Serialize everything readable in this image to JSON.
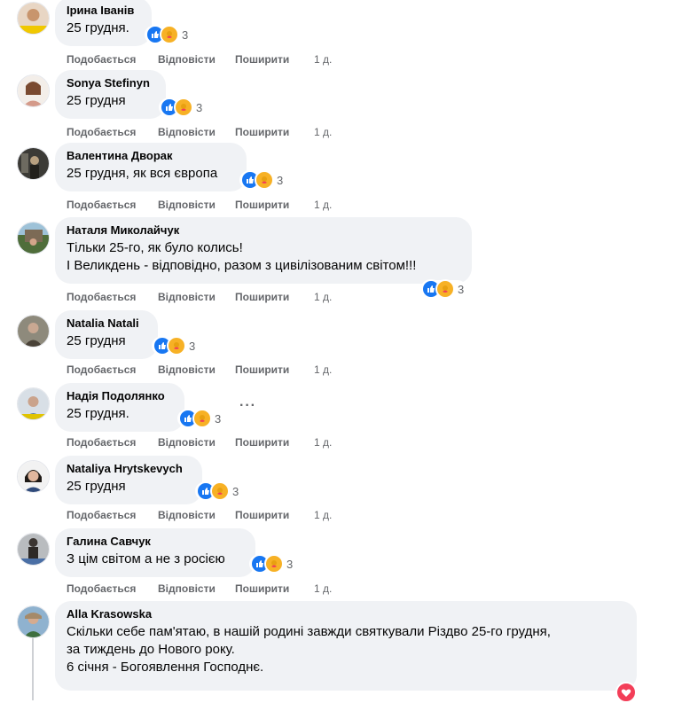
{
  "labels": {
    "like": "Подобається",
    "reply": "Відповісти",
    "share": "Поширити"
  },
  "comments": [
    {
      "author": "Ірина Іванів",
      "lines": [
        "25 грудня."
      ],
      "reactions": "3",
      "time": "1 д."
    },
    {
      "author": "Sonya Stefinyn",
      "lines": [
        "25 грудня"
      ],
      "reactions": "3",
      "time": "1 д."
    },
    {
      "author": "Валентина Дворак",
      "lines": [
        "25 грудня, як вся європа"
      ],
      "reactions": "3",
      "time": "1 д."
    },
    {
      "author": "Наталя Миколайчук",
      "lines": [
        "Тільки 25-го, як було колись!",
        "І Великдень - відповідно, разом з цивілізованим світом!!!"
      ],
      "reactions": "3",
      "time": "1 д."
    },
    {
      "author": "Natalia Natali",
      "lines": [
        "25 грудня"
      ],
      "reactions": "3",
      "time": "1 д."
    },
    {
      "author": "Надія Подолянко",
      "lines": [
        "25 грудня."
      ],
      "reactions": "3",
      "time": "1 д."
    },
    {
      "author": "Nataliya Hrytskevych",
      "lines": [
        "25 грудня"
      ],
      "reactions": "3",
      "time": "1 д."
    },
    {
      "author": "Галина Савчук",
      "lines": [
        "З цім світом а не з росією"
      ],
      "reactions": "3",
      "time": "1 д."
    },
    {
      "author": "Alla Krasowska",
      "lines": [
        "Скільки себе пам'ятаю, в нашій родині завжди святкували Різдво 25-го грудня,",
        "за тиждень до Нового року.",
        "6 січня - Богоявлення Господнє."
      ]
    }
  ],
  "more_options_icon": "more-horizontal-icon",
  "reaction_icons": [
    "like-icon",
    "care-icon",
    "love-icon"
  ],
  "colors": {
    "like": "#1877f2",
    "care": "#f7b125",
    "love": "#f33e58",
    "link_gray": "#65676b",
    "bubble": "#f0f2f5"
  }
}
